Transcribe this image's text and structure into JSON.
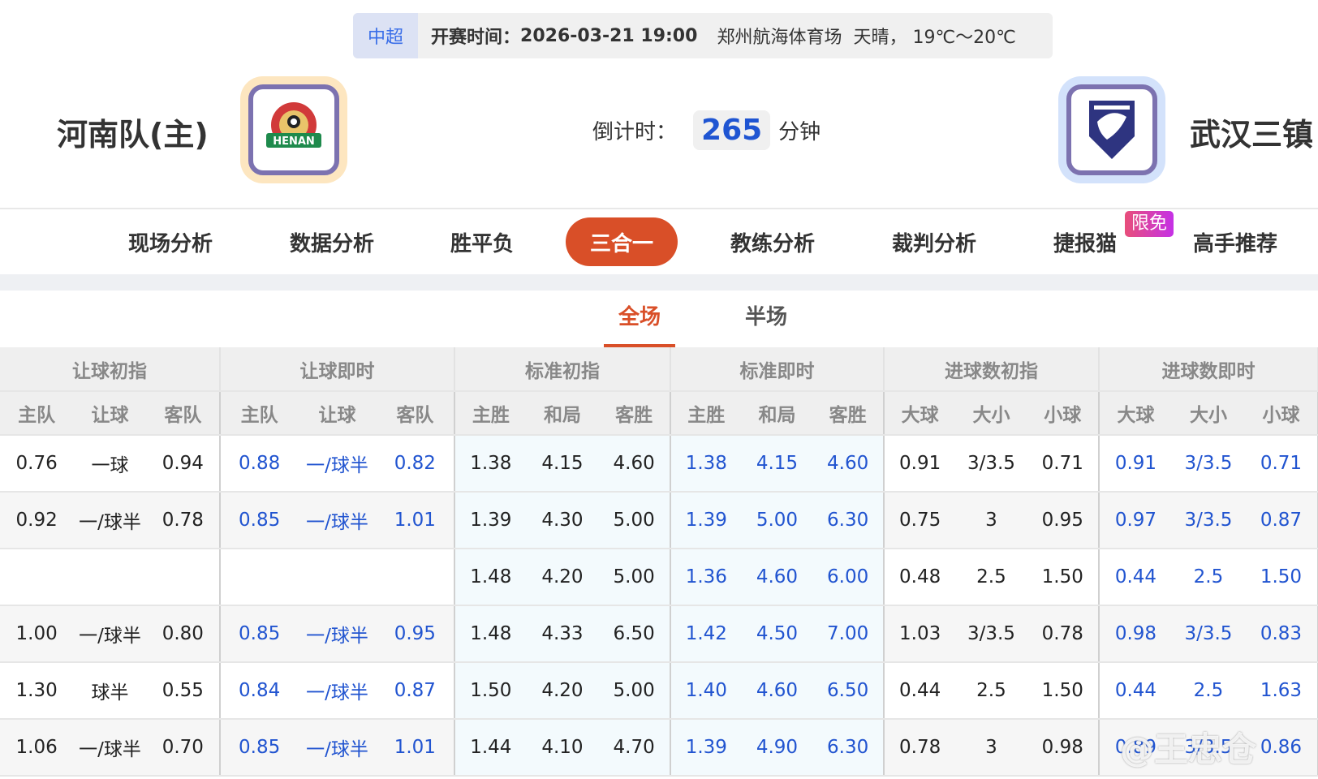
{
  "header": {
    "league": "中超",
    "time_label": "开赛时间：",
    "time": "2026-03-21 19:00",
    "venue": "郑州航海体育场",
    "weather": "天晴， 19℃～20℃"
  },
  "home": {
    "name": "河南队(主)",
    "logo_text": "HENAN"
  },
  "away": {
    "name": "武汉三镇"
  },
  "countdown": {
    "label": "倒计时：",
    "value": "265",
    "unit": "分钟"
  },
  "nav": {
    "items": [
      "现场分析",
      "数据分析",
      "胜平负",
      "三合一",
      "教练分析",
      "裁判分析",
      "捷报猫",
      "高手推荐"
    ],
    "badge": "限免",
    "active": "三合一"
  },
  "subtabs": [
    "全场",
    "半场"
  ],
  "table": {
    "groups": [
      "让球初指",
      "让球即时",
      "标准初指",
      "标准即时",
      "进球数初指",
      "进球数即时"
    ],
    "subheaders": [
      "主队",
      "让球",
      "客队",
      "主队",
      "让球",
      "客队",
      "主胜",
      "和局",
      "客胜",
      "主胜",
      "和局",
      "客胜",
      "大球",
      "大小",
      "小球",
      "大球",
      "大小",
      "小球"
    ],
    "rows": [
      [
        "0.76",
        "一球",
        "0.94",
        "0.88",
        "一/球半",
        "0.82",
        "1.38",
        "4.15",
        "4.60",
        "1.38",
        "4.15",
        "4.60",
        "0.91",
        "3/3.5",
        "0.71",
        "0.91",
        "3/3.5",
        "0.71"
      ],
      [
        "0.92",
        "一/球半",
        "0.78",
        "0.85",
        "一/球半",
        "1.01",
        "1.39",
        "4.30",
        "5.00",
        "1.39",
        "5.00",
        "6.30",
        "0.75",
        "3",
        "0.95",
        "0.97",
        "3/3.5",
        "0.87"
      ],
      [
        "",
        "",
        "",
        "",
        "",
        "",
        "1.48",
        "4.20",
        "5.00",
        "1.36",
        "4.60",
        "6.00",
        "0.48",
        "2.5",
        "1.50",
        "0.44",
        "2.5",
        "1.50"
      ],
      [
        "1.00",
        "一/球半",
        "0.80",
        "0.85",
        "一/球半",
        "0.95",
        "1.48",
        "4.33",
        "6.50",
        "1.42",
        "4.50",
        "7.00",
        "1.03",
        "3/3.5",
        "0.78",
        "0.98",
        "3/3.5",
        "0.83"
      ],
      [
        "1.30",
        "球半",
        "0.55",
        "0.84",
        "一/球半",
        "0.87",
        "1.50",
        "4.20",
        "5.00",
        "1.40",
        "4.60",
        "6.50",
        "0.44",
        "2.5",
        "1.50",
        "0.44",
        "2.5",
        "1.63"
      ],
      [
        "1.06",
        "一/球半",
        "0.70",
        "0.85",
        "一/球半",
        "1.01",
        "1.44",
        "4.10",
        "4.70",
        "1.39",
        "4.90",
        "6.30",
        "0.78",
        "3",
        "0.98",
        "0.89",
        "3/3.5",
        "0.86"
      ]
    ]
  },
  "watermark": "@王忠仓"
}
